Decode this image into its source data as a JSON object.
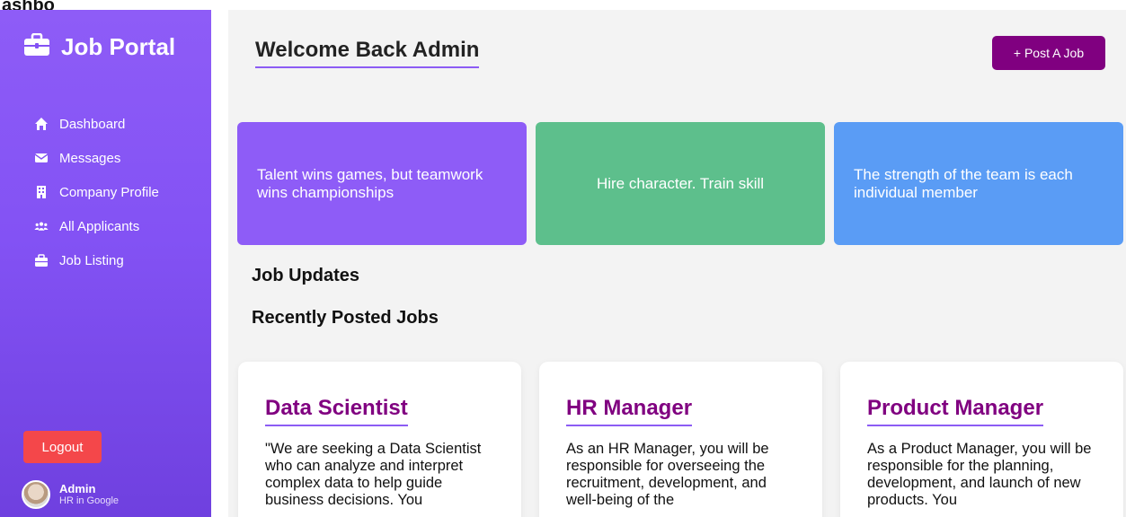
{
  "top_cut_text": "ashbo",
  "brand": {
    "title": "Job Portal",
    "icon": "briefcase-icon"
  },
  "nav": [
    {
      "label": "Dashboard",
      "icon": "home-icon"
    },
    {
      "label": "Messages",
      "icon": "envelope-icon"
    },
    {
      "label": "Company Profile",
      "icon": "building-icon"
    },
    {
      "label": "All Applicants",
      "icon": "users-icon"
    },
    {
      "label": "Job Listing",
      "icon": "briefcase-icon"
    }
  ],
  "logout_label": "Logout",
  "user": {
    "name": "Admin",
    "role": "HR in Google"
  },
  "header": {
    "welcome": "Welcome Back Admin",
    "post_job": "+ Post A Job"
  },
  "quotes": [
    {
      "text": "Talent wins games, but teamwork wins championships",
      "color": "#8e5cf7"
    },
    {
      "text": "Hire character. Train skill",
      "color": "#5dbf8c"
    },
    {
      "text": "The strength of the team is each individual member",
      "color": "#5a9cf5"
    }
  ],
  "sections": {
    "job_updates": "Job Updates",
    "recent_jobs": "Recently Posted Jobs"
  },
  "jobs": [
    {
      "title": "Data Scientist",
      "desc": "\"We are seeking a Data Scientist who can analyze and interpret complex data to help guide business decisions. You"
    },
    {
      "title": "HR Manager",
      "desc": "As an HR Manager, you will be responsible for overseeing the recruitment, development, and well-being of the"
    },
    {
      "title": "Product Manager",
      "desc": "As a Product Manager, you will be responsible for the planning, development, and launch of new products. You"
    }
  ],
  "colors": {
    "accent": "#8e5cf7",
    "brand_purple": "#800080",
    "logout_red": "#f4474a"
  }
}
